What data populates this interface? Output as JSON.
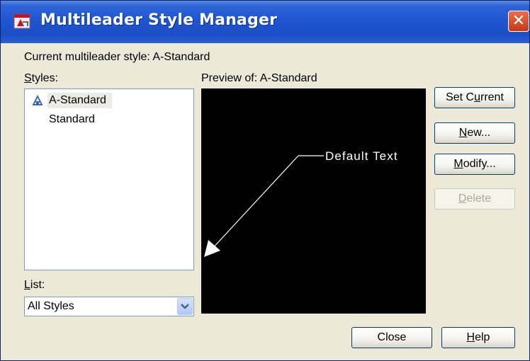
{
  "window": {
    "title": "Multileader Style Manager",
    "close_glyph": "✕",
    "app_icon": "autocad-icon"
  },
  "current_style": {
    "label": "Current multileader style: A-Standard"
  },
  "styles": {
    "label_underlined": "S",
    "label_rest": "tyles:",
    "items": [
      {
        "label": "A-Standard",
        "selected": true,
        "icon": "annotative-icon"
      },
      {
        "label": "Standard",
        "selected": false,
        "icon": ""
      }
    ]
  },
  "list": {
    "label_underlined": "L",
    "label_rest": "ist:",
    "value": "All Styles",
    "dropdown_icon": "chevron-down-icon"
  },
  "preview": {
    "label": "Preview of: A-Standard",
    "sample_text": "Default Text"
  },
  "buttons": {
    "set_current": {
      "pre": "Set C",
      "ul": "u",
      "post": "rrent"
    },
    "new": {
      "pre": "",
      "ul": "N",
      "post": "ew..."
    },
    "modify": {
      "pre": "",
      "ul": "M",
      "post": "odify..."
    },
    "delete": {
      "pre": "",
      "ul": "D",
      "post": "elete",
      "disabled": true
    },
    "close": {
      "label": "Close"
    },
    "help": {
      "pre": "",
      "ul": "H",
      "post": "elp"
    }
  },
  "colors": {
    "title_bar": "#1f55d0",
    "dialog_bg": "#ece9d8",
    "preview_bg": "#000000",
    "leader": "#ffffff"
  }
}
